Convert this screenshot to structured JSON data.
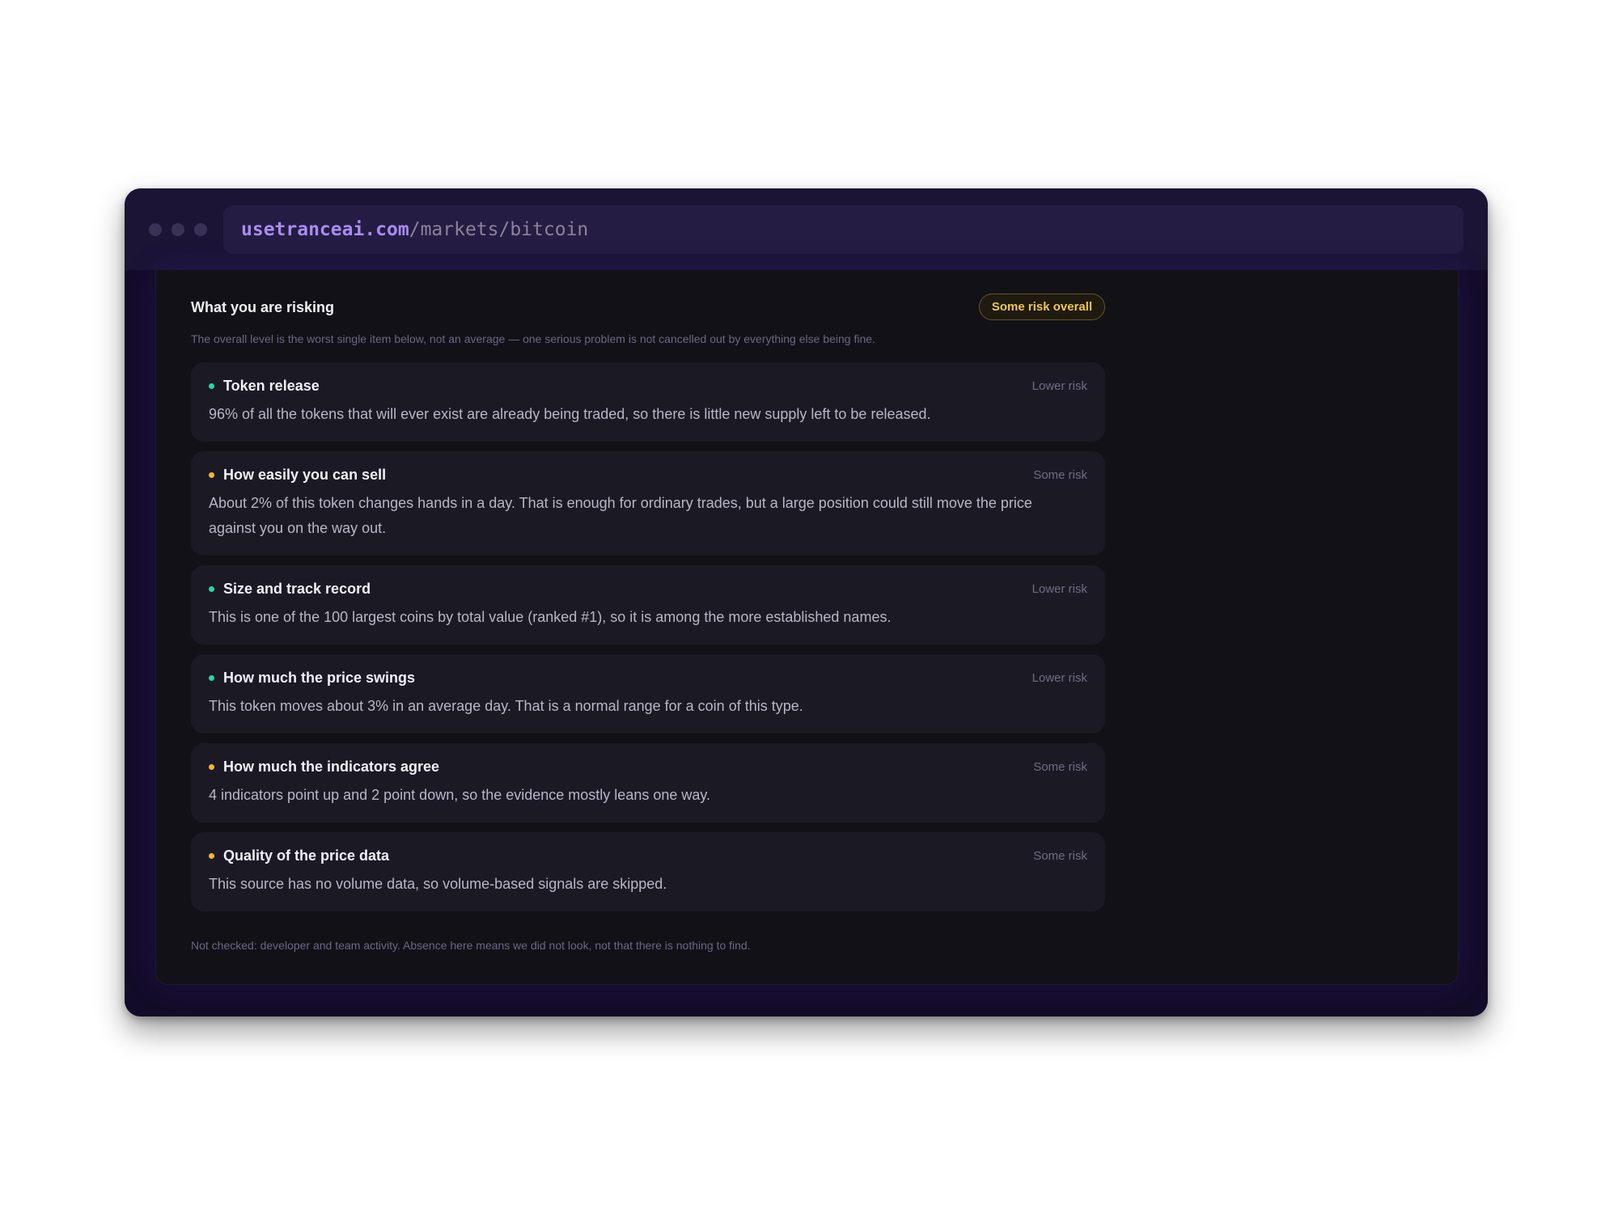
{
  "browser": {
    "url_host": "usetranceai.com",
    "url_path": "/markets/bitcoin"
  },
  "panel": {
    "title": "What you are risking",
    "overall_badge": "Some risk overall",
    "subtitle": "The overall level is the worst single item below, not an average — one serious problem is not cancelled out by everything else being fine.",
    "footnote": "Not checked: developer and team activity. Absence here means we did not look, not that there is nothing to find."
  },
  "colors": {
    "lower_risk": "#2dd4a7",
    "some_risk": "#f5b731",
    "badge_text": "#f2c64a",
    "url_host": "#a98cf2"
  },
  "items": [
    {
      "title": "Token release",
      "level": "Lower risk",
      "status": "lower",
      "text": "96% of all the tokens that will ever exist are already being traded, so there is little new supply left to be released."
    },
    {
      "title": "How easily you can sell",
      "level": "Some risk",
      "status": "some",
      "text": "About 2% of this token changes hands in a day. That is enough for ordinary trades, but a large position could still move the price against you on the way out."
    },
    {
      "title": "Size and track record",
      "level": "Lower risk",
      "status": "lower",
      "text": "This is one of the 100 largest coins by total value (ranked #1), so it is among the more established names."
    },
    {
      "title": "How much the price swings",
      "level": "Lower risk",
      "status": "lower",
      "text": "This token moves about 3% in an average day. That is a normal range for a coin of this type."
    },
    {
      "title": "How much the indicators agree",
      "level": "Some risk",
      "status": "some",
      "text": "4 indicators point up and 2 point down, so the evidence mostly leans one way."
    },
    {
      "title": "Quality of the price data",
      "level": "Some risk",
      "status": "some",
      "text": "This source has no volume data, so volume-based signals are skipped."
    }
  ]
}
